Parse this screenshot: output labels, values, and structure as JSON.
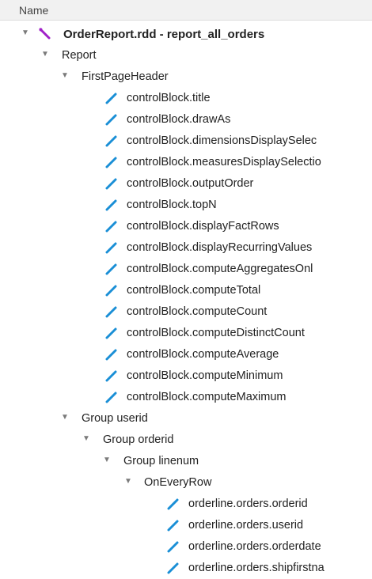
{
  "header": {
    "name_label": "Name"
  },
  "colors": {
    "header_bg": "#f1f1f1",
    "root_icon": "#a020c8",
    "leaf_icon": "#1a8fd6",
    "disclosure": "#7a7a7a"
  },
  "tree": {
    "root": {
      "label": "OrderReport.rdd - report_all_orders",
      "icon": "purple-pencil-icon"
    },
    "report": {
      "label": "Report"
    },
    "first_page_header": {
      "label": "FirstPageHeader"
    },
    "control_blocks": [
      "controlBlock.title",
      "controlBlock.drawAs",
      "controlBlock.dimensionsDisplaySelec",
      "controlBlock.measuresDisplaySelectio",
      "controlBlock.outputOrder",
      "controlBlock.topN",
      "controlBlock.displayFactRows",
      "controlBlock.displayRecurringValues",
      "controlBlock.computeAggregatesOnl",
      "controlBlock.computeTotal",
      "controlBlock.computeCount",
      "controlBlock.computeDistinctCount",
      "controlBlock.computeAverage",
      "controlBlock.computeMinimum",
      "controlBlock.computeMaximum"
    ],
    "group_userid": {
      "label": "Group userid"
    },
    "group_orderid": {
      "label": "Group orderid"
    },
    "group_linenum": {
      "label": "Group linenum"
    },
    "on_every_row": {
      "label": "OnEveryRow"
    },
    "orderline_fields": [
      "orderline.orders.orderid",
      "orderline.orders.userid",
      "orderline.orders.orderdate",
      "orderline.orders.shipfirstna"
    ]
  }
}
